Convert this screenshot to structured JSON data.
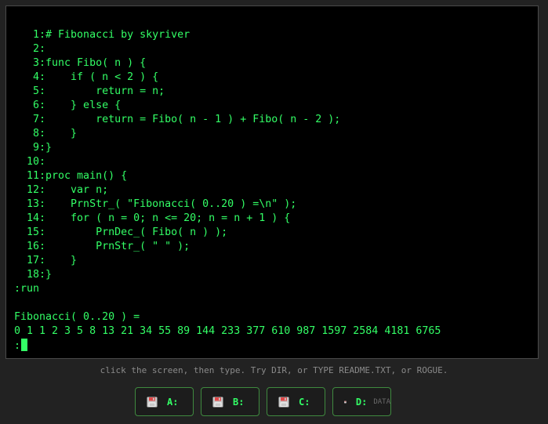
{
  "terminal": {
    "lines": [
      "   1:# Fibonacci by skyriver",
      "   2:",
      "   3:func Fibo( n ) {",
      "   4:    if ( n < 2 ) {",
      "   5:        return = n;",
      "   6:    } else {",
      "   7:        return = Fibo( n - 1 ) + Fibo( n - 2 );",
      "   8:    }",
      "   9:}",
      "  10:",
      "  11:proc main() {",
      "  12:    var n;",
      "  13:    PrnStr_( \"Fibonacci( 0..20 ) =\\n\" );",
      "  14:    for ( n = 0; n <= 20; n = n + 1 ) {",
      "  15:        PrnDec_( Fibo( n ) );",
      "  16:        PrnStr_( \" \" );",
      "  17:    }",
      "  18:}",
      ":run",
      "",
      "Fibonacci( 0..20 ) =",
      "0 1 1 2 3 5 8 13 21 34 55 89 144 233 377 610 987 1597 2584 4181 6765"
    ],
    "prompt": ":",
    "text_color": "#33ff66",
    "background": "#000000"
  },
  "hint": "click the screen, then type. Try DIR, or TYPE README.TXT, or ROGUE.",
  "drives": [
    {
      "label": "A:",
      "sub": "",
      "icon": "floppy-disk-icon"
    },
    {
      "label": "B:",
      "sub": "",
      "icon": "floppy-disk-icon"
    },
    {
      "label": "C:",
      "sub": "",
      "icon": "floppy-disk-icon"
    },
    {
      "label": "D:",
      "sub": "DATA",
      "icon": "floppy-disk-icon"
    }
  ],
  "colors": {
    "accent": "#33ff66",
    "drive_border": "#3f8a3f",
    "floppy_red": "#e04848"
  }
}
